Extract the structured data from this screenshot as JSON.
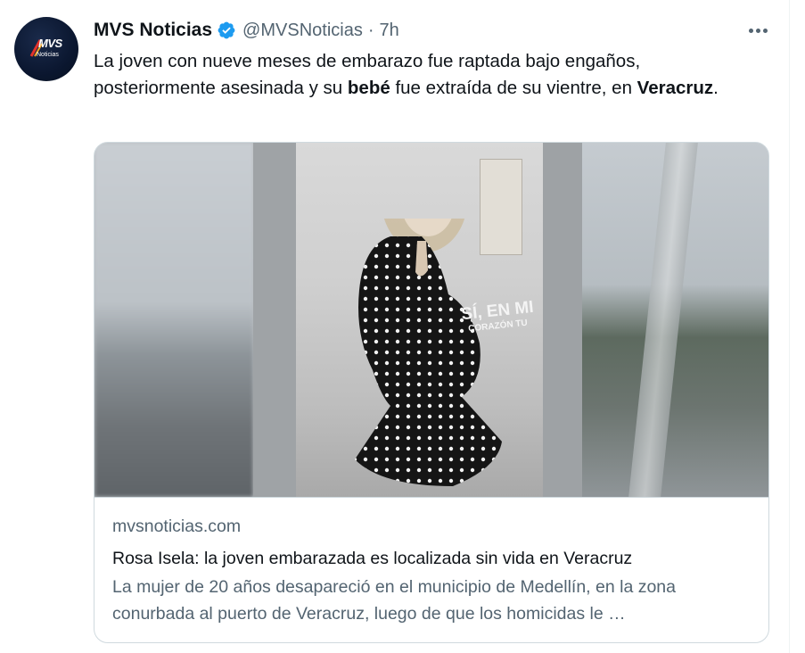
{
  "author": {
    "name": "MVS Noticias",
    "handle": "@MVSNoticias",
    "separator": "·",
    "time": "7h",
    "avatar_logo": "MVS",
    "avatar_sub": "Noticias"
  },
  "tweet": {
    "text_1": "La joven con nueve meses de embarazo fue raptada bajo engaños, posteriormente asesinada y su ",
    "text_bold_1": "bebé",
    "text_2": " fue extraída de su vientre, en ",
    "text_bold_2": "Veracruz",
    "text_3": "."
  },
  "card": {
    "image_overlay_line1": "SÍ, EN MI",
    "image_overlay_line2": "CORAZÓN TU",
    "domain": "mvsnoticias.com",
    "title": "Rosa Isela: la joven embarazada es localizada sin vida en Veracruz",
    "description": "La mujer de 20 años desapareció en el municipio de Medellín, en la zona conurbada al puerto de Veracruz, luego de que los homicidas le …"
  },
  "icons": {
    "verified": "verified-badge-icon",
    "more": "more-options-icon"
  },
  "colors": {
    "verified": "#1d9bf0",
    "secondary_text": "#536471",
    "primary_text": "#0f1419",
    "border": "#cfd9de"
  }
}
